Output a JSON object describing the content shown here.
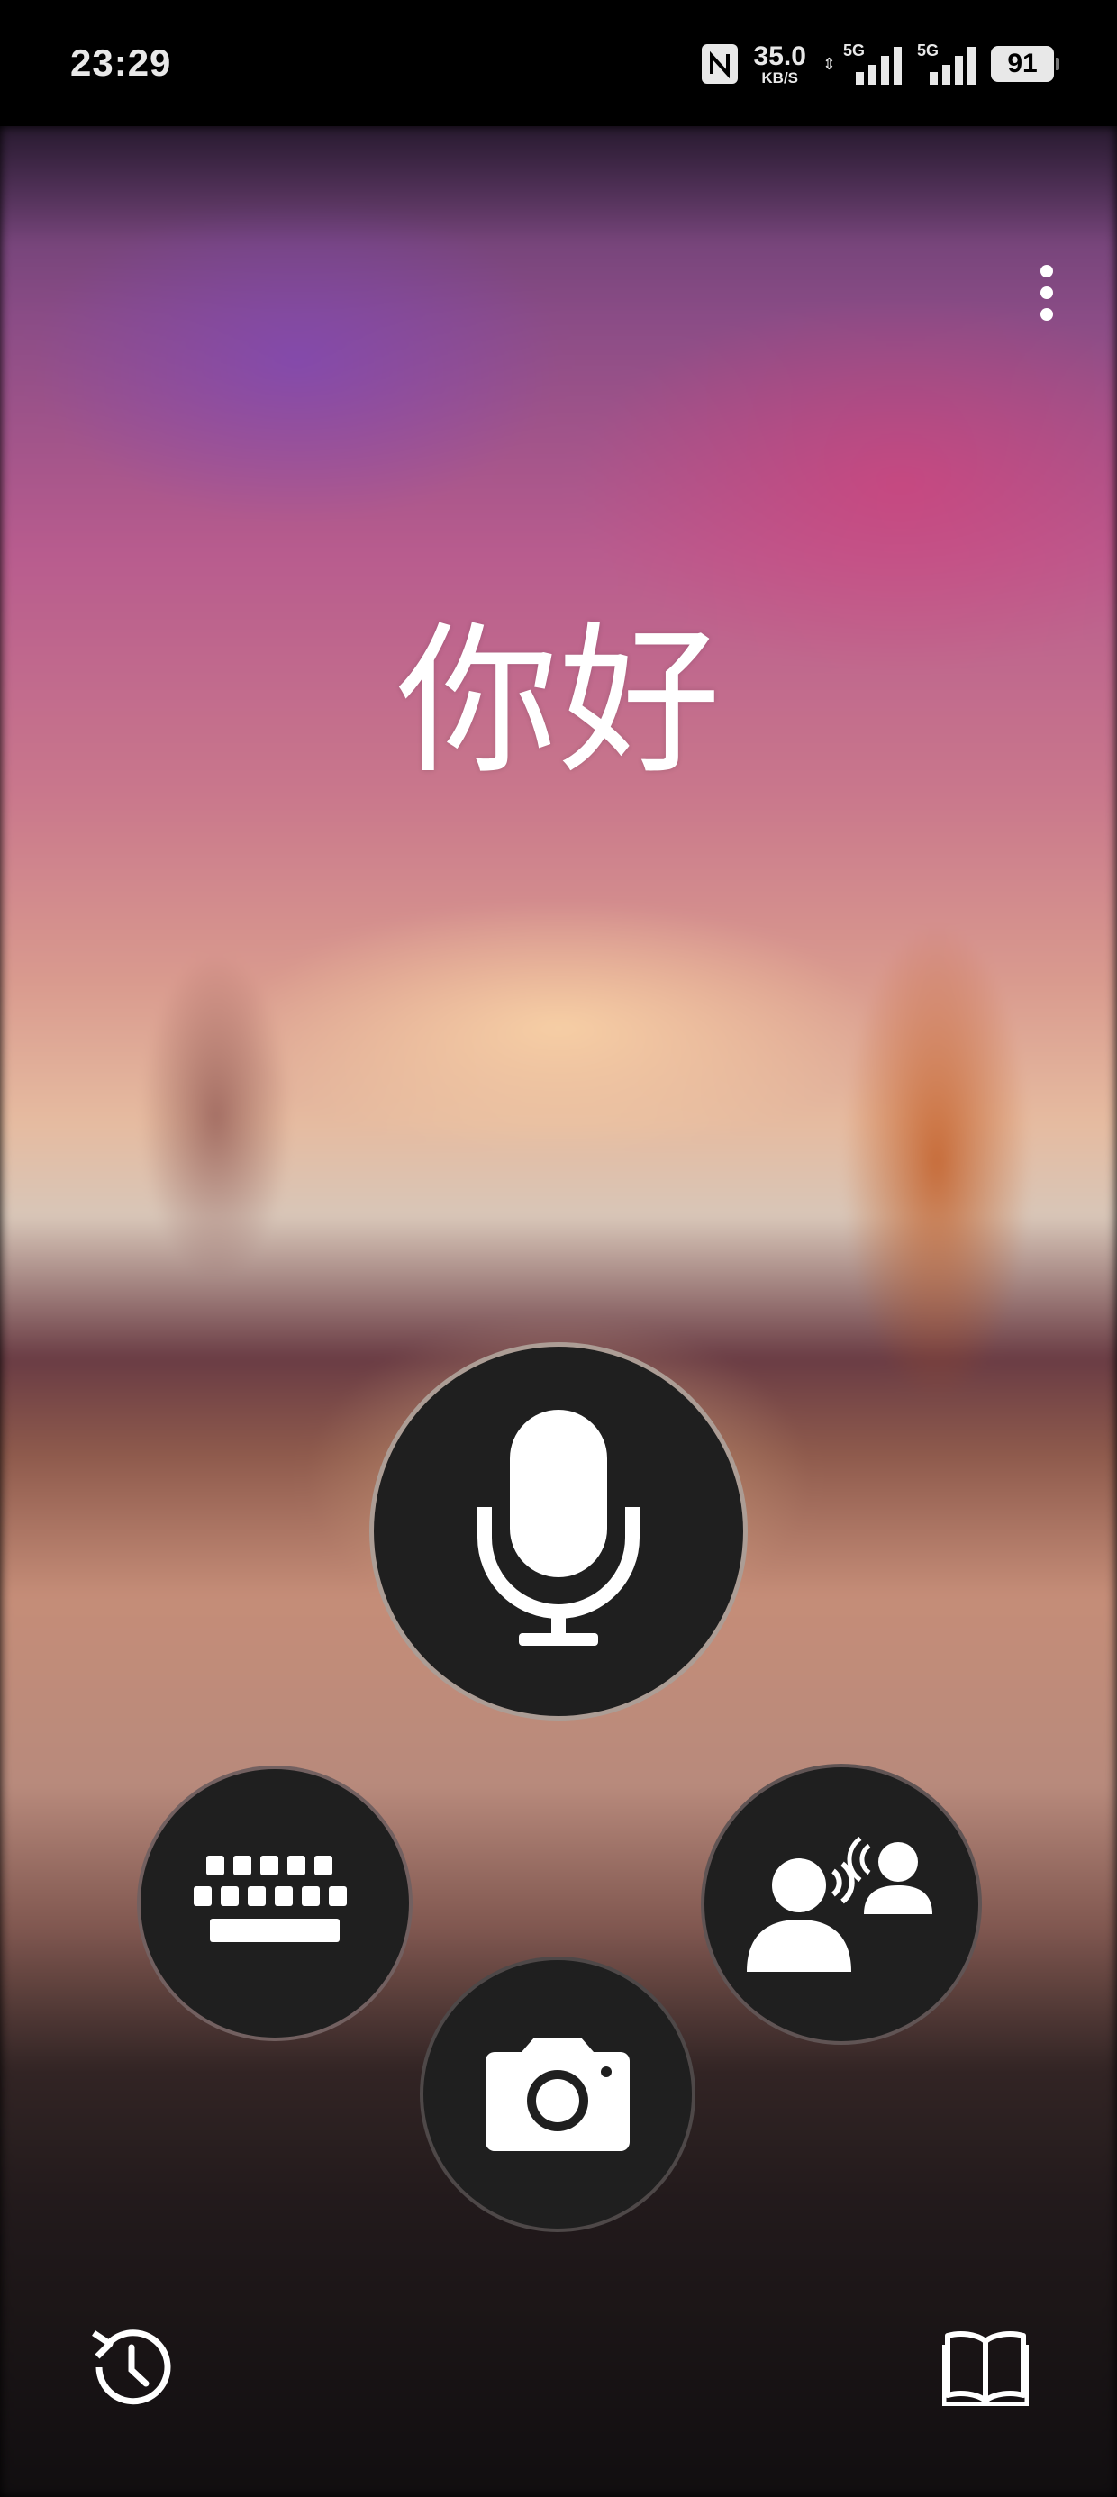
{
  "status_bar": {
    "time": "23:29",
    "nfc_icon": "nfc-icon",
    "network_speed_value": "35.0",
    "network_speed_unit": "KB/S",
    "updown_glyph": "⇕",
    "sim1_tag": "5G",
    "sim2_tag": "5G",
    "battery_level": "91"
  },
  "header": {
    "menu_icon": "more-vertical-icon"
  },
  "main": {
    "greeting": "你好"
  },
  "actions": {
    "microphone": "microphone-icon",
    "keyboard": "keyboard-icon",
    "conversation": "conversation-icon",
    "camera": "camera-icon"
  },
  "bottom_bar": {
    "history": "history-icon",
    "phrasebook": "book-icon"
  },
  "colors": {
    "button_bg": "#1f1f1f",
    "icon": "#ffffff"
  }
}
